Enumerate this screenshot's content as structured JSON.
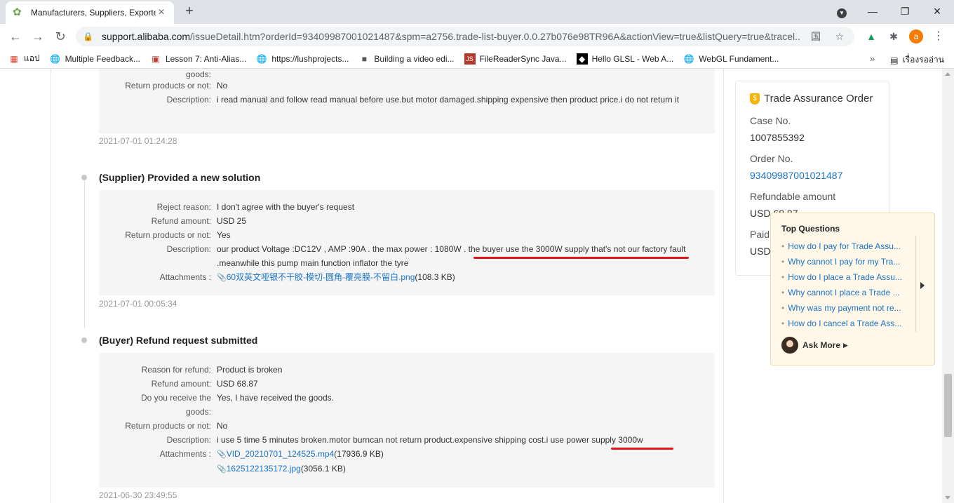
{
  "browser": {
    "tab_title": "Manufacturers, Suppliers, Exporte",
    "url_host": "support.alibaba.com",
    "url_path": "/issueDetail.htm?orderId=93409987001021487&spm=a2756.trade-list-buyer.0.0.27b076e98TR96A&actionView=true&listQuery=true&tracel...",
    "avatar_letter": "a",
    "bookmarks": [
      {
        "label": "แอป",
        "icon": "apps-grid-icon"
      },
      {
        "label": "Multiple Feedback...",
        "icon": "globe-icon"
      },
      {
        "label": "Lesson 7: Anti-Alias...",
        "icon": "slide-icon"
      },
      {
        "label": "https://lushprojects...",
        "icon": "globe-icon"
      },
      {
        "label": "Building a video edi...",
        "icon": "photo-icon"
      },
      {
        "label": "FileReaderSync Java...",
        "icon": "js-icon"
      },
      {
        "label": "Hello GLSL - Web A...",
        "icon": "glsl-icon"
      },
      {
        "label": "WebGL Fundament...",
        "icon": "globe-icon"
      }
    ],
    "reading_list": "เรื่องรออ่าน"
  },
  "events": {
    "e0": {
      "goods_tail": "goods:",
      "return_label": "Return products or not:",
      "return_value": "No",
      "desc_label": "Description:",
      "desc_value": "i read manual and follow read manual before use.but motor damaged.shipping expensive then product price.i do not return it",
      "timestamp": "2021-07-01 01:24:28"
    },
    "e1": {
      "title": "(Supplier) Provided a new solution",
      "reject_label": "Reject reason:",
      "reject_value": "I don't agree with the buyer's request",
      "amount_label": "Refund amount:",
      "amount_value": "USD 25",
      "return_label": "Return products or not:",
      "return_value": "Yes",
      "desc_label": "Description:",
      "desc_value": "our product Voltage :DC12V , AMP :90A . the max power : 1080W . the buyer use the 3000W supply that's not our factory fault .meanwhile this pump main function inflator the tyre",
      "attach_label": "Attachments :",
      "attach_name": "60双英文哑银不干胶-模切-圆角-覆亮膜-不留白.png",
      "attach_size": "(108.3 KB)",
      "timestamp": "2021-07-01 00:05:34"
    },
    "e2": {
      "title": "(Buyer) Refund request submitted",
      "reason_label": "Reason for refund:",
      "reason_value": "Product is broken",
      "amount_label": "Refund amount:",
      "amount_value": "USD 68.87",
      "receive_label_1": "Do you receive the",
      "receive_label_2": "goods:",
      "receive_value": "Yes, I have received the goods.",
      "return_label": "Return products or not:",
      "return_value": "No",
      "desc_label": "Description:",
      "desc_value": "i use 5 time 5 minutes broken.motor burncan not return product.expensive shipping cost.i use power supply 3000w",
      "attach_label": "Attachments :",
      "attach1_name": "VID_20210701_124525.mp4",
      "attach1_size": "(17936.9 KB)",
      "attach2_name": "1625122135172.jpg",
      "attach2_size": "(3056.1 KB)",
      "timestamp": "2021-06-30 23:49:55"
    }
  },
  "order_card": {
    "title": "Trade Assurance Order",
    "case_label": "Case No.",
    "case_value": "1007855392",
    "order_label": "Order No.",
    "order_value": "93409987001021487",
    "refundable_label": "Refundable amount",
    "refundable_value": "USD 68.87",
    "paid_label": "Paid",
    "paid_value": "USD"
  },
  "top_questions": {
    "heading": "Top Questions",
    "items": [
      "How do I pay for Trade Assu...",
      "Why cannot I pay for my Tra...",
      "How do I place a Trade Assu...",
      "Why cannot I place a Trade ...",
      "Why was my payment not re...",
      "How do I cancel a Trade Ass..."
    ],
    "ask_more": "Ask More"
  },
  "colors": {
    "link": "#1a73c8",
    "annotation": "#e0161b",
    "shield": "#f5b400"
  }
}
